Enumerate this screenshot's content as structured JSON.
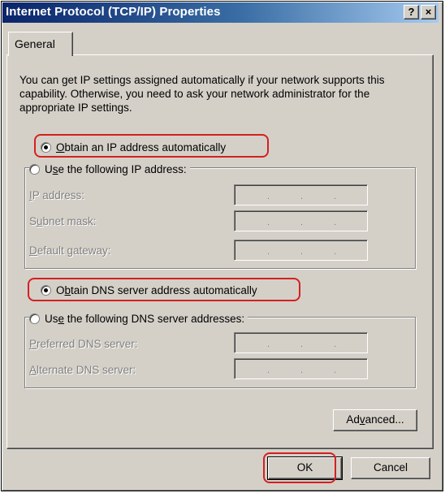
{
  "window": {
    "title": "Internet Protocol (TCP/IP) Properties",
    "help_label": "?",
    "close_label": "×"
  },
  "tabs": [
    {
      "label": "General",
      "active": true
    }
  ],
  "description": "You can get IP settings assigned automatically if your network supports this capability. Otherwise, you need to ask your network administrator for the appropriate IP settings.",
  "ip": {
    "auto": {
      "pre": "",
      "accel": "O",
      "post": "btain an IP address automatically",
      "checked": true
    },
    "manual": {
      "pre": "U",
      "accel": "s",
      "post": "e the following IP address:",
      "checked": false
    },
    "fields": [
      {
        "pre": "",
        "accel": "I",
        "post": "P address:"
      },
      {
        "pre": "S",
        "accel": "u",
        "post": "bnet mask:"
      },
      {
        "pre": "",
        "accel": "D",
        "post": "efault gateway:"
      }
    ]
  },
  "dns": {
    "auto": {
      "pre": "O",
      "accel": "b",
      "post": "tain DNS server address automatically",
      "checked": true
    },
    "manual": {
      "pre": "Us",
      "accel": "e",
      "post": " the following DNS server addresses:",
      "checked": false
    },
    "fields": [
      {
        "pre": "",
        "accel": "P",
        "post": "referred DNS server:"
      },
      {
        "pre": "",
        "accel": "A",
        "post": "lternate DNS server:"
      }
    ]
  },
  "ip_separator": ".",
  "buttons": {
    "advanced": {
      "pre": "Ad",
      "accel": "v",
      "post": "anced..."
    },
    "ok": "OK",
    "cancel": "Cancel"
  },
  "highlight_color": "#d42020"
}
